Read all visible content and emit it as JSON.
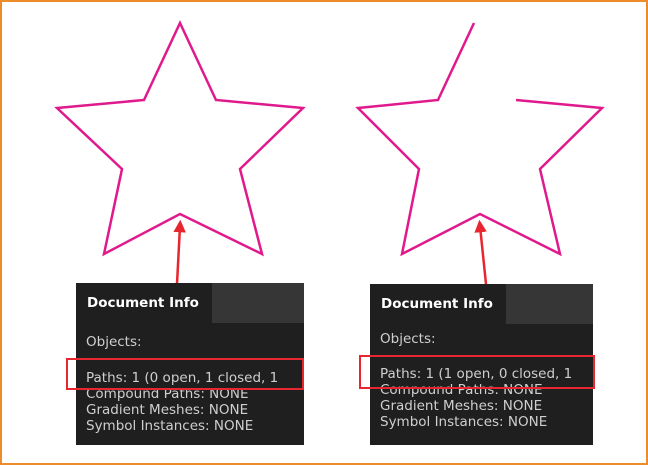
{
  "colors": {
    "frame_border": "#ee8b2b",
    "star_stroke": "#e0198c",
    "arrow": "#e8262f",
    "panel_bg": "#1f1f1f",
    "panel_tabbar_bg": "#363636"
  },
  "stars": [
    {
      "name": "closed-star",
      "path_state": "closed"
    },
    {
      "name": "open-star",
      "path_state": "open"
    }
  ],
  "panels": [
    {
      "tab_label": "Document Info",
      "objects_label": "Objects:",
      "paths": "Paths: 1 (0 open, 1 closed, 1",
      "compound_paths": "Compound Paths: NONE",
      "gradient_meshes": "Gradient Meshes: NONE",
      "symbol_instances": "Symbol Instances: NONE"
    },
    {
      "tab_label": "Document Info",
      "objects_label": "Objects:",
      "paths": "Paths: 1 (1 open, 0 closed, 1",
      "compound_paths": "Compound Paths: NONE",
      "gradient_meshes": "Gradient Meshes: NONE",
      "symbol_instances": "Symbol Instances: NONE"
    }
  ]
}
